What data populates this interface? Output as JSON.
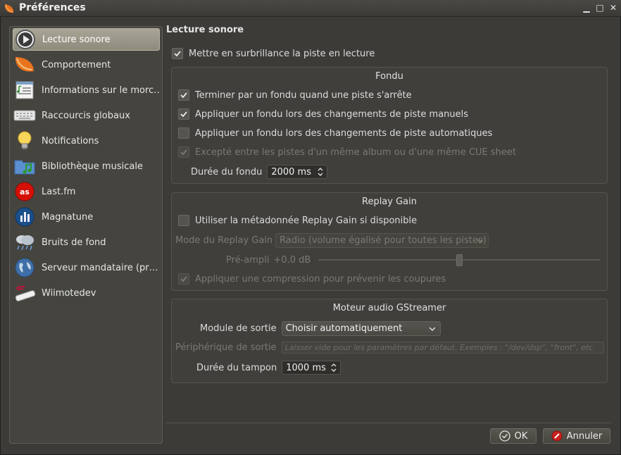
{
  "window": {
    "title": "Préférences",
    "controls": {
      "minimize": "▁",
      "maximize": "□",
      "close": "✕"
    }
  },
  "sidebar": {
    "items": [
      {
        "label": "Lecture sonore",
        "icon": "play-icon",
        "active": true
      },
      {
        "label": "Comportement",
        "icon": "clementine-icon"
      },
      {
        "label": "Informations sur le morc…",
        "icon": "song-info-icon"
      },
      {
        "label": "Raccourcis globaux",
        "icon": "keyboard-icon"
      },
      {
        "label": "Notifications",
        "icon": "lightbulb-icon"
      },
      {
        "label": "Bibliothèque musicale",
        "icon": "music-folder-icon"
      },
      {
        "label": "Last.fm",
        "icon": "lastfm-icon"
      },
      {
        "label": "Magnatune",
        "icon": "magnatune-icon"
      },
      {
        "label": "Bruits de fond",
        "icon": "rain-cloud-icon"
      },
      {
        "label": "Serveur mandataire (pr…",
        "icon": "globe-icon"
      },
      {
        "label": "Wiimotedev",
        "icon": "wiimote-icon"
      }
    ]
  },
  "main": {
    "section_title": "Lecture sonore",
    "highlight_track": {
      "label": "Mettre en surbrillance la piste en lecture",
      "checked": true
    },
    "fade": {
      "title": "Fondu",
      "fade_on_stop": {
        "label": "Terminer par un fondu quand une piste s'arrête",
        "checked": true
      },
      "fade_manual": {
        "label": "Appliquer un fondu lors des changements de piste manuels",
        "checked": true
      },
      "fade_auto": {
        "label": "Appliquer un fondu lors des changements de piste automatiques",
        "checked": false
      },
      "except_album": {
        "label": "Excepté entre les pistes d'un même album ou d'une même CUE sheet",
        "checked": true,
        "disabled": true
      },
      "duration_label": "Durée du fondu",
      "duration_value": "2000 ms"
    },
    "replay_gain": {
      "title": "Replay Gain",
      "use_metadata": {
        "label": "Utiliser la métadonnée Replay Gain si disponible",
        "checked": false
      },
      "mode_label": "Mode du Replay Gain",
      "mode_value": "Radio (volume égalisé pour toutes les pistes)",
      "preamp_label": "Pré-ampli",
      "preamp_value": "+0.0 dB",
      "preamp_level": 0.5,
      "compression": {
        "label": "Appliquer une compression pour prévenir les coupures",
        "checked": true,
        "disabled": true
      }
    },
    "gstreamer": {
      "title": "Moteur audio GStreamer",
      "output_label": "Module de sortie",
      "output_value": "Choisir automatiquement",
      "device_label": "Périphérique de sortie",
      "device_placeholder": "Laisser vide pour les paramètres par défaut. Exemples : \"/dev/dsp\", \"front\", etc",
      "buffer_label": "Durée du tampon",
      "buffer_value": "1000 ms"
    }
  },
  "buttons": {
    "ok": "OK",
    "cancel": "Annuler"
  }
}
